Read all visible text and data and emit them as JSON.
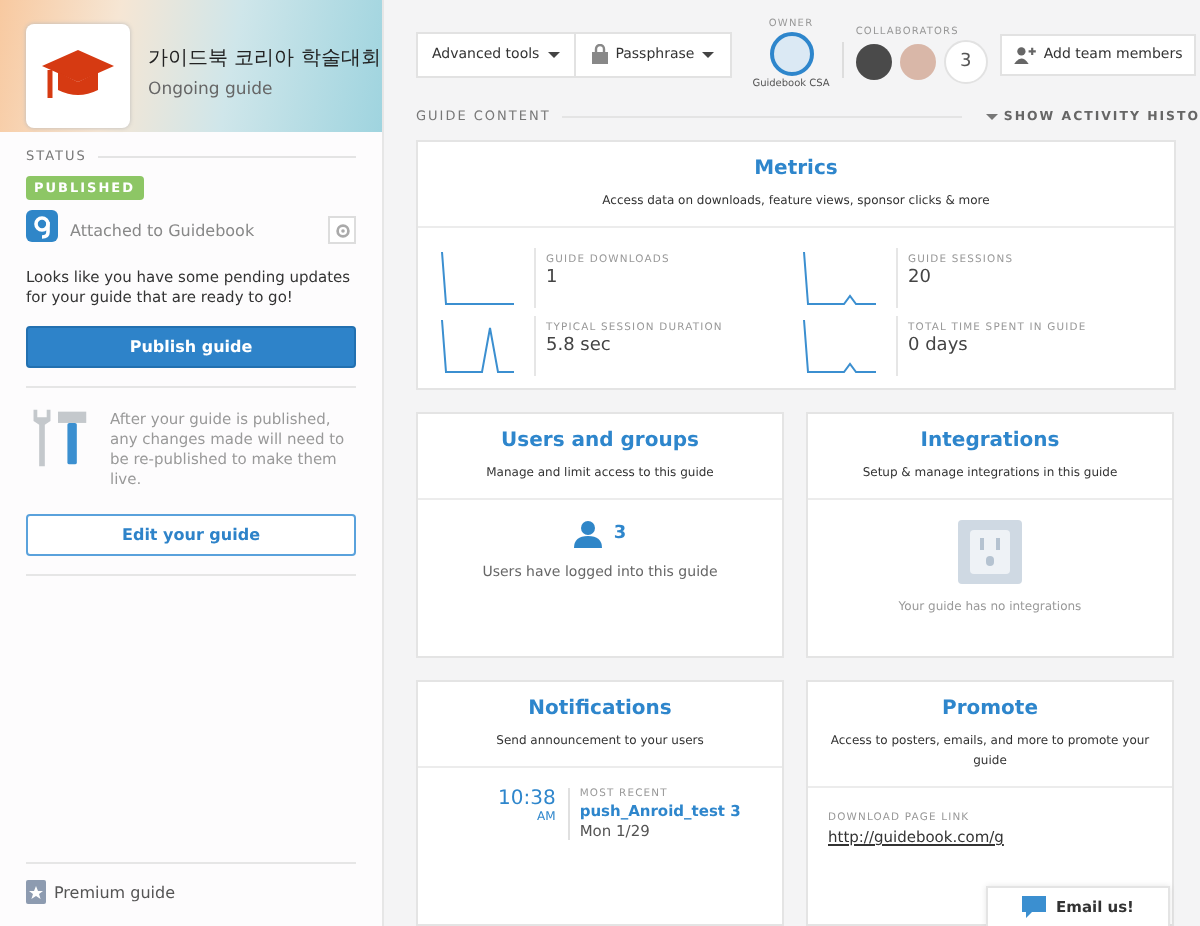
{
  "guide": {
    "title": "가이드북 코리아 학술대회",
    "subtitle": "Ongoing guide"
  },
  "status": {
    "heading": "STATUS",
    "badge": "PUBLISHED",
    "attached": "Attached to Guidebook",
    "message": "Looks like you have some pending updates for your guide that are ready to go!",
    "publish_button": "Publish guide",
    "note": "After your guide is published, any changes made will need to be re-published to make them live.",
    "edit_button": "Edit your guide"
  },
  "footer": {
    "label": "Premium guide"
  },
  "toolbar": {
    "advanced_tools": "Advanced tools",
    "passphrase": "Passphrase",
    "owner_label": "OWNER",
    "owner_name": "Guidebook CSA",
    "collaborators_label": "COLLABORATORS",
    "collaborator_count": "3",
    "add_button": "Add team members"
  },
  "section": {
    "title": "GUIDE CONTENT",
    "activity_toggle": "SHOW ACTIVITY HISTO"
  },
  "metrics": {
    "title": "Metrics",
    "description": "Access data on downloads, feature views, sponsor clicks & more",
    "stats": [
      {
        "label": "GUIDE DOWNLOADS",
        "value": "1"
      },
      {
        "label": "GUIDE SESSIONS",
        "value": "20"
      },
      {
        "label": "TYPICAL SESSION DURATION",
        "value": "5.8 sec"
      },
      {
        "label": "TOTAL TIME SPENT IN GUIDE",
        "value": "0 days"
      }
    ]
  },
  "users": {
    "title": "Users and groups",
    "description": "Manage and limit access to this guide",
    "count": "3",
    "caption": "Users have logged into this guide"
  },
  "integrations": {
    "title": "Integrations",
    "description": "Setup & manage integrations in this guide",
    "caption": "Your guide has no integrations"
  },
  "notifications": {
    "title": "Notifications",
    "description": "Send announcement to your users",
    "time": "10:38",
    "meridiem": "AM",
    "recent_label": "MOST RECENT",
    "name": "push_Anroid_test 3",
    "date": "Mon 1/29"
  },
  "promote": {
    "title": "Promote",
    "description": "Access to posters, emails, and more to promote your guide",
    "link_label": "DOWNLOAD PAGE LINK",
    "link": "http://guidebook.com/g"
  },
  "chat": {
    "label": "Email us!"
  }
}
